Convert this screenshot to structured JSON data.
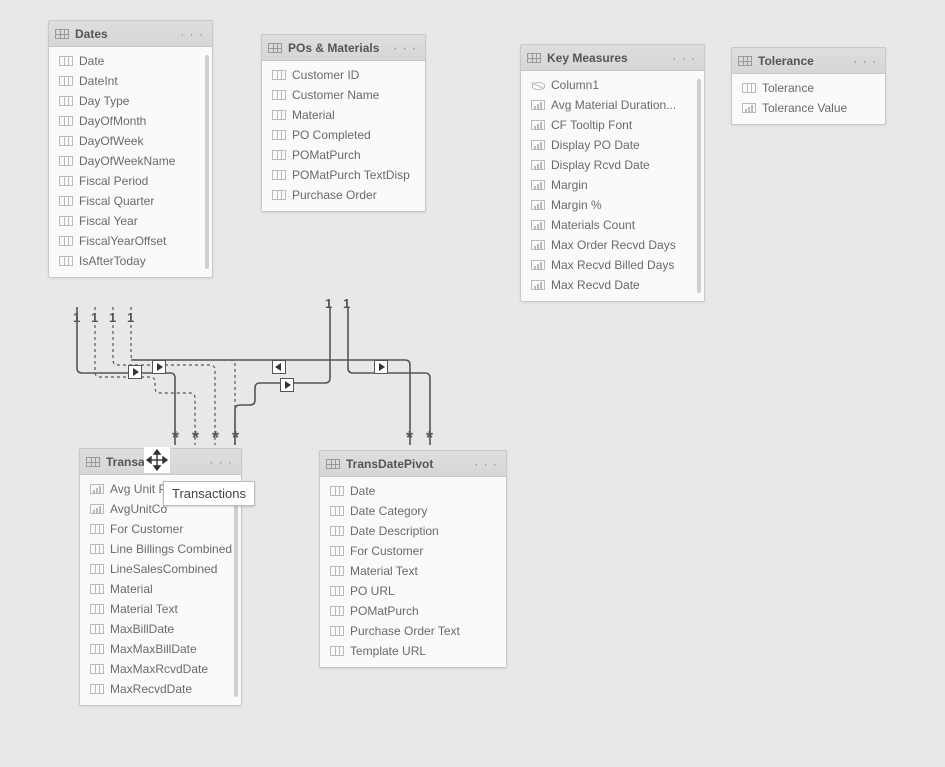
{
  "tables": {
    "dates": {
      "title": "Dates",
      "fields": [
        {
          "icon": "col",
          "label": "Date"
        },
        {
          "icon": "col",
          "label": "DateInt"
        },
        {
          "icon": "col",
          "label": "Day Type"
        },
        {
          "icon": "col",
          "label": "DayOfMonth"
        },
        {
          "icon": "col",
          "label": "DayOfWeek"
        },
        {
          "icon": "col",
          "label": "DayOfWeekName"
        },
        {
          "icon": "col",
          "label": "Fiscal Period"
        },
        {
          "icon": "col",
          "label": "Fiscal Quarter"
        },
        {
          "icon": "col",
          "label": "Fiscal Year"
        },
        {
          "icon": "col",
          "label": "FiscalYearOffset"
        },
        {
          "icon": "col",
          "label": "IsAfterToday"
        }
      ],
      "scroll": true
    },
    "pos": {
      "title": "POs & Materials",
      "fields": [
        {
          "icon": "col",
          "label": "Customer ID"
        },
        {
          "icon": "col",
          "label": "Customer Name"
        },
        {
          "icon": "col",
          "label": "Material"
        },
        {
          "icon": "col",
          "label": "PO Completed"
        },
        {
          "icon": "col",
          "label": "POMatPurch"
        },
        {
          "icon": "col",
          "label": "POMatPurch TextDisp"
        },
        {
          "icon": "col",
          "label": "Purchase Order"
        }
      ],
      "scroll": false
    },
    "keymeasures": {
      "title": "Key Measures",
      "fields": [
        {
          "icon": "hidden",
          "label": "Column1"
        },
        {
          "icon": "meas",
          "label": "Avg Material Duration..."
        },
        {
          "icon": "meas",
          "label": "CF Tooltip Font"
        },
        {
          "icon": "meas",
          "label": "Display PO Date"
        },
        {
          "icon": "meas",
          "label": "Display Rcvd Date"
        },
        {
          "icon": "meas",
          "label": "Margin"
        },
        {
          "icon": "meas",
          "label": "Margin %"
        },
        {
          "icon": "meas",
          "label": "Materials Count"
        },
        {
          "icon": "meas",
          "label": "Max Order Recvd Days"
        },
        {
          "icon": "meas",
          "label": "Max Recvd Billed Days"
        },
        {
          "icon": "meas",
          "label": "Max Recvd Date"
        }
      ],
      "scroll": true
    },
    "tolerance": {
      "title": "Tolerance",
      "fields": [
        {
          "icon": "col",
          "label": "Tolerance"
        },
        {
          "icon": "meas",
          "label": "Tolerance Value"
        }
      ],
      "scroll": false
    },
    "transactions": {
      "title": "Transactions",
      "title_truncated": "Transa",
      "fields": [
        {
          "icon": "meas",
          "label": "Avg Unit P"
        },
        {
          "icon": "meas",
          "label": "AvgUnitCo"
        },
        {
          "icon": "col",
          "label": "For Customer"
        },
        {
          "icon": "col",
          "label": "Line Billings Combined"
        },
        {
          "icon": "col",
          "label": "LineSalesCombined"
        },
        {
          "icon": "col",
          "label": "Material"
        },
        {
          "icon": "col",
          "label": "Material Text"
        },
        {
          "icon": "col",
          "label": "MaxBillDate"
        },
        {
          "icon": "col",
          "label": "MaxMaxBillDate"
        },
        {
          "icon": "col",
          "label": "MaxMaxRcvdDate"
        },
        {
          "icon": "col",
          "label": "MaxRecvdDate"
        }
      ],
      "scroll": true
    },
    "transdatepivot": {
      "title": "TransDatePivot",
      "fields": [
        {
          "icon": "col",
          "label": "Date"
        },
        {
          "icon": "col",
          "label": "Date Category"
        },
        {
          "icon": "col",
          "label": "Date Description"
        },
        {
          "icon": "col",
          "label": "For Customer"
        },
        {
          "icon": "col",
          "label": "Material Text"
        },
        {
          "icon": "col",
          "label": "PO URL"
        },
        {
          "icon": "col",
          "label": "POMatPurch"
        },
        {
          "icon": "col",
          "label": "Purchase Order Text"
        },
        {
          "icon": "col",
          "label": "Template URL"
        }
      ],
      "scroll": false
    }
  },
  "cardinality": {
    "one": "1",
    "many": "*"
  },
  "tooltip": "Transactions",
  "more_glyph": "· · ·"
}
